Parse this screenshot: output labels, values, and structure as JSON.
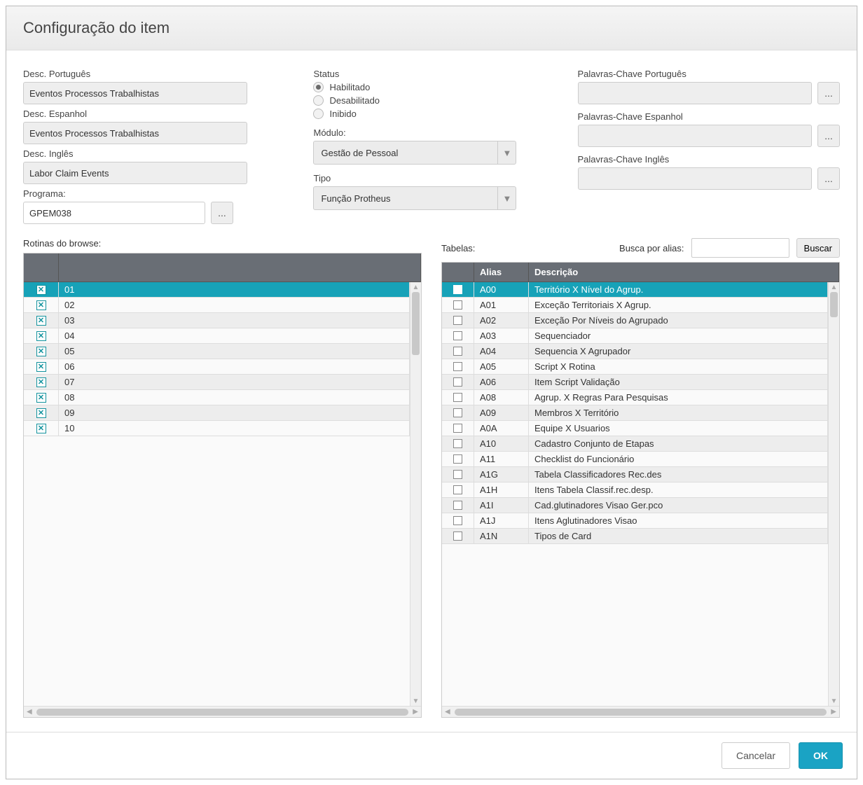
{
  "title": "Configuração do item",
  "labels": {
    "desc_pt": "Desc. Português",
    "desc_es": "Desc. Espanhol",
    "desc_en": "Desc. Inglês",
    "programa": "Programa:",
    "status": "Status",
    "modulo": "Módulo:",
    "tipo": "Tipo",
    "kw_pt": "Palavras-Chave Português",
    "kw_es": "Palavras-Chave Espanhol",
    "kw_en": "Palavras-Chave Inglês",
    "rotinas": "Rotinas do browse:",
    "tabelas": "Tabelas:",
    "busca": "Busca por alias:",
    "buscar": "Buscar",
    "cancel": "Cancelar",
    "ok": "OK",
    "ellipsis": "..."
  },
  "values": {
    "desc_pt": "Eventos Processos Trabalhistas",
    "desc_es": "Eventos Processos Trabalhistas",
    "desc_en": "Labor Claim Events",
    "programa": "GPEM038",
    "modulo": "Gestão de Pessoal",
    "tipo": "Função Protheus"
  },
  "status": {
    "options": [
      "Habilitado",
      "Desabilitado",
      "Inibido"
    ],
    "selected": 0
  },
  "rotinas": [
    "01",
    "02",
    "03",
    "04",
    "05",
    "06",
    "07",
    "08",
    "09",
    "10"
  ],
  "tabelas_headers": {
    "alias": "Alias",
    "descricao": "Descrição"
  },
  "tabelas": [
    {
      "alias": "A00",
      "desc": "Território X Nível do Agrup.",
      "sel": true
    },
    {
      "alias": "A01",
      "desc": "Exceção Territoriais X Agrup."
    },
    {
      "alias": "A02",
      "desc": "Exceção Por Níveis do Agrupado"
    },
    {
      "alias": "A03",
      "desc": "Sequenciador"
    },
    {
      "alias": "A04",
      "desc": "Sequencia X Agrupador"
    },
    {
      "alias": "A05",
      "desc": "Script X Rotina"
    },
    {
      "alias": "A06",
      "desc": "Item Script Validação"
    },
    {
      "alias": "A08",
      "desc": "Agrup. X Regras Para Pesquisas"
    },
    {
      "alias": "A09",
      "desc": "Membros X Território"
    },
    {
      "alias": "A0A",
      "desc": "Equipe X Usuarios"
    },
    {
      "alias": "A10",
      "desc": "Cadastro Conjunto de Etapas"
    },
    {
      "alias": "A11",
      "desc": "Checklist do Funcionário"
    },
    {
      "alias": "A1G",
      "desc": "Tabela Classificadores Rec.des"
    },
    {
      "alias": "A1H",
      "desc": "Itens Tabela Classif.rec.desp."
    },
    {
      "alias": "A1I",
      "desc": "Cad.glutinadores Visao Ger.pco"
    },
    {
      "alias": "A1J",
      "desc": "Itens Aglutinadores Visao"
    },
    {
      "alias": "A1N",
      "desc": "Tipos de Card"
    }
  ]
}
